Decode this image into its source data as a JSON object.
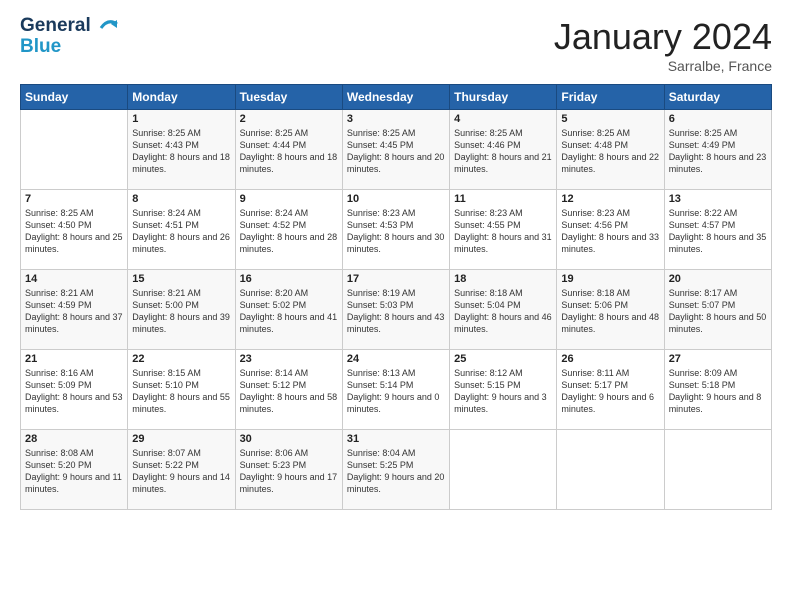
{
  "header": {
    "logo_line1": "General",
    "logo_line2": "Blue",
    "title": "January 2024",
    "location": "Sarralbe, France"
  },
  "days_of_week": [
    "Sunday",
    "Monday",
    "Tuesday",
    "Wednesday",
    "Thursday",
    "Friday",
    "Saturday"
  ],
  "weeks": [
    [
      {
        "day": "",
        "sunrise": "",
        "sunset": "",
        "daylight": ""
      },
      {
        "day": "1",
        "sunrise": "Sunrise: 8:25 AM",
        "sunset": "Sunset: 4:43 PM",
        "daylight": "Daylight: 8 hours and 18 minutes."
      },
      {
        "day": "2",
        "sunrise": "Sunrise: 8:25 AM",
        "sunset": "Sunset: 4:44 PM",
        "daylight": "Daylight: 8 hours and 18 minutes."
      },
      {
        "day": "3",
        "sunrise": "Sunrise: 8:25 AM",
        "sunset": "Sunset: 4:45 PM",
        "daylight": "Daylight: 8 hours and 20 minutes."
      },
      {
        "day": "4",
        "sunrise": "Sunrise: 8:25 AM",
        "sunset": "Sunset: 4:46 PM",
        "daylight": "Daylight: 8 hours and 21 minutes."
      },
      {
        "day": "5",
        "sunrise": "Sunrise: 8:25 AM",
        "sunset": "Sunset: 4:48 PM",
        "daylight": "Daylight: 8 hours and 22 minutes."
      },
      {
        "day": "6",
        "sunrise": "Sunrise: 8:25 AM",
        "sunset": "Sunset: 4:49 PM",
        "daylight": "Daylight: 8 hours and 23 minutes."
      }
    ],
    [
      {
        "day": "7",
        "sunrise": "Sunrise: 8:25 AM",
        "sunset": "Sunset: 4:50 PM",
        "daylight": "Daylight: 8 hours and 25 minutes."
      },
      {
        "day": "8",
        "sunrise": "Sunrise: 8:24 AM",
        "sunset": "Sunset: 4:51 PM",
        "daylight": "Daylight: 8 hours and 26 minutes."
      },
      {
        "day": "9",
        "sunrise": "Sunrise: 8:24 AM",
        "sunset": "Sunset: 4:52 PM",
        "daylight": "Daylight: 8 hours and 28 minutes."
      },
      {
        "day": "10",
        "sunrise": "Sunrise: 8:23 AM",
        "sunset": "Sunset: 4:53 PM",
        "daylight": "Daylight: 8 hours and 30 minutes."
      },
      {
        "day": "11",
        "sunrise": "Sunrise: 8:23 AM",
        "sunset": "Sunset: 4:55 PM",
        "daylight": "Daylight: 8 hours and 31 minutes."
      },
      {
        "day": "12",
        "sunrise": "Sunrise: 8:23 AM",
        "sunset": "Sunset: 4:56 PM",
        "daylight": "Daylight: 8 hours and 33 minutes."
      },
      {
        "day": "13",
        "sunrise": "Sunrise: 8:22 AM",
        "sunset": "Sunset: 4:57 PM",
        "daylight": "Daylight: 8 hours and 35 minutes."
      }
    ],
    [
      {
        "day": "14",
        "sunrise": "Sunrise: 8:21 AM",
        "sunset": "Sunset: 4:59 PM",
        "daylight": "Daylight: 8 hours and 37 minutes."
      },
      {
        "day": "15",
        "sunrise": "Sunrise: 8:21 AM",
        "sunset": "Sunset: 5:00 PM",
        "daylight": "Daylight: 8 hours and 39 minutes."
      },
      {
        "day": "16",
        "sunrise": "Sunrise: 8:20 AM",
        "sunset": "Sunset: 5:02 PM",
        "daylight": "Daylight: 8 hours and 41 minutes."
      },
      {
        "day": "17",
        "sunrise": "Sunrise: 8:19 AM",
        "sunset": "Sunset: 5:03 PM",
        "daylight": "Daylight: 8 hours and 43 minutes."
      },
      {
        "day": "18",
        "sunrise": "Sunrise: 8:18 AM",
        "sunset": "Sunset: 5:04 PM",
        "daylight": "Daylight: 8 hours and 46 minutes."
      },
      {
        "day": "19",
        "sunrise": "Sunrise: 8:18 AM",
        "sunset": "Sunset: 5:06 PM",
        "daylight": "Daylight: 8 hours and 48 minutes."
      },
      {
        "day": "20",
        "sunrise": "Sunrise: 8:17 AM",
        "sunset": "Sunset: 5:07 PM",
        "daylight": "Daylight: 8 hours and 50 minutes."
      }
    ],
    [
      {
        "day": "21",
        "sunrise": "Sunrise: 8:16 AM",
        "sunset": "Sunset: 5:09 PM",
        "daylight": "Daylight: 8 hours and 53 minutes."
      },
      {
        "day": "22",
        "sunrise": "Sunrise: 8:15 AM",
        "sunset": "Sunset: 5:10 PM",
        "daylight": "Daylight: 8 hours and 55 minutes."
      },
      {
        "day": "23",
        "sunrise": "Sunrise: 8:14 AM",
        "sunset": "Sunset: 5:12 PM",
        "daylight": "Daylight: 8 hours and 58 minutes."
      },
      {
        "day": "24",
        "sunrise": "Sunrise: 8:13 AM",
        "sunset": "Sunset: 5:14 PM",
        "daylight": "Daylight: 9 hours and 0 minutes."
      },
      {
        "day": "25",
        "sunrise": "Sunrise: 8:12 AM",
        "sunset": "Sunset: 5:15 PM",
        "daylight": "Daylight: 9 hours and 3 minutes."
      },
      {
        "day": "26",
        "sunrise": "Sunrise: 8:11 AM",
        "sunset": "Sunset: 5:17 PM",
        "daylight": "Daylight: 9 hours and 6 minutes."
      },
      {
        "day": "27",
        "sunrise": "Sunrise: 8:09 AM",
        "sunset": "Sunset: 5:18 PM",
        "daylight": "Daylight: 9 hours and 8 minutes."
      }
    ],
    [
      {
        "day": "28",
        "sunrise": "Sunrise: 8:08 AM",
        "sunset": "Sunset: 5:20 PM",
        "daylight": "Daylight: 9 hours and 11 minutes."
      },
      {
        "day": "29",
        "sunrise": "Sunrise: 8:07 AM",
        "sunset": "Sunset: 5:22 PM",
        "daylight": "Daylight: 9 hours and 14 minutes."
      },
      {
        "day": "30",
        "sunrise": "Sunrise: 8:06 AM",
        "sunset": "Sunset: 5:23 PM",
        "daylight": "Daylight: 9 hours and 17 minutes."
      },
      {
        "day": "31",
        "sunrise": "Sunrise: 8:04 AM",
        "sunset": "Sunset: 5:25 PM",
        "daylight": "Daylight: 9 hours and 20 minutes."
      },
      {
        "day": "",
        "sunrise": "",
        "sunset": "",
        "daylight": ""
      },
      {
        "day": "",
        "sunrise": "",
        "sunset": "",
        "daylight": ""
      },
      {
        "day": "",
        "sunrise": "",
        "sunset": "",
        "daylight": ""
      }
    ]
  ]
}
